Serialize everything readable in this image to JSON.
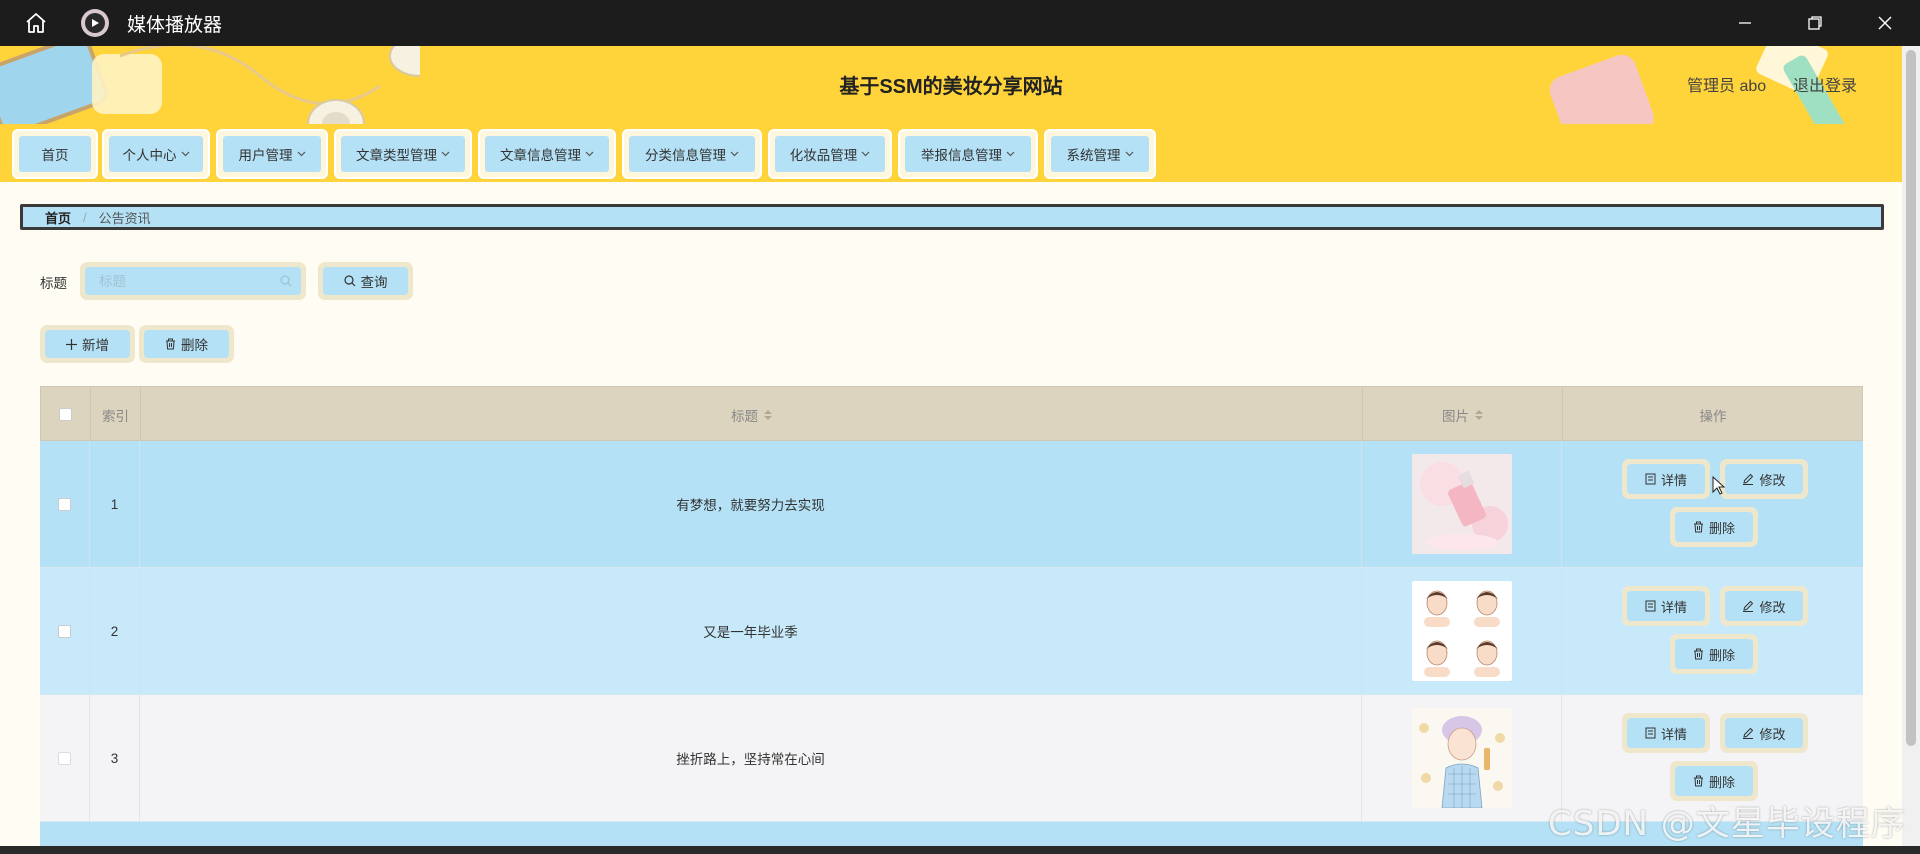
{
  "window": {
    "title": "媒体播放器",
    "icons": {
      "home": "home-icon",
      "app": "media-player-icon",
      "minimize": "minimize-icon",
      "restore": "restore-icon",
      "close": "close-icon"
    }
  },
  "header": {
    "site_title": "基于SSM的美妆分享网站",
    "admin_label": "管理员 abo",
    "logout_label": "退出登录"
  },
  "nav": {
    "items": [
      {
        "label": "首页",
        "dropdown": false
      },
      {
        "label": "个人中心",
        "dropdown": true
      },
      {
        "label": "用户管理",
        "dropdown": true
      },
      {
        "label": "文章类型管理",
        "dropdown": true
      },
      {
        "label": "文章信息管理",
        "dropdown": true
      },
      {
        "label": "分类信息管理",
        "dropdown": true
      },
      {
        "label": "化妆品管理",
        "dropdown": true
      },
      {
        "label": "举报信息管理",
        "dropdown": true
      },
      {
        "label": "系统管理",
        "dropdown": true
      }
    ]
  },
  "breadcrumb": {
    "home": "首页",
    "separator": "/",
    "current": "公告资讯"
  },
  "search": {
    "label": "标题",
    "placeholder": "标题",
    "value": "",
    "query_button": "查询"
  },
  "actions": {
    "add_button": "新增",
    "delete_button": "删除"
  },
  "table": {
    "columns": {
      "index": "索引",
      "title": "标题",
      "image": "图片",
      "operation": "操作"
    },
    "row_buttons": {
      "detail": "详情",
      "edit": "修改",
      "delete": "删除"
    },
    "rows": [
      {
        "index": "1",
        "title": "有梦想，就要努力去实现",
        "image": "pink-perfume-bottle"
      },
      {
        "index": "2",
        "title": "又是一年毕业季",
        "image": "face-care-illustration"
      },
      {
        "index": "3",
        "title": "挫折路上，坚持常在心间",
        "image": "girl-cosmetics-illustration"
      }
    ]
  },
  "watermark": "CSDN @文星毕设程序",
  "colors": {
    "accent_yellow": "#ffd43b",
    "button_blue": "#b4e1f5",
    "row_blue": "#b4e1f5",
    "row_light_blue": "#c8e9f9",
    "row_gray": "#f4f4f6",
    "table_header": "#ddd4bf"
  }
}
